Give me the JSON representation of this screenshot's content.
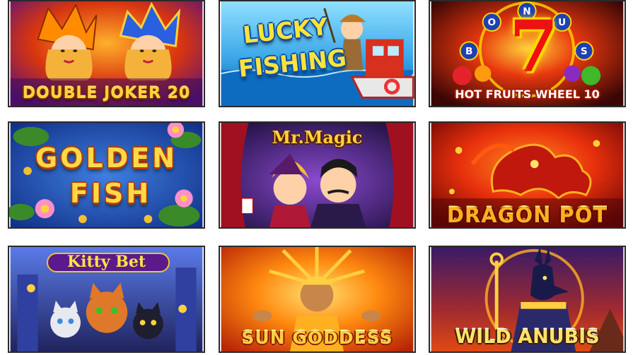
{
  "games": [
    {
      "title": "DOUBLE JOKER 20",
      "bg_top": "#d9360f",
      "bg_bottom": "#5a1278",
      "accent": "#ffd23a"
    },
    {
      "title_line1": "LUCKY",
      "title_line2": "FISHING",
      "bg_top": "#5fc4f2",
      "bg_bottom": "#0b67b8",
      "accent": "#ffe23a"
    },
    {
      "title": "HOT FRUITS WHEEL 10",
      "reel_letters": [
        "B",
        "O",
        "N",
        "U",
        "S"
      ],
      "big_symbol": "7",
      "bg_top": "#b01010",
      "bg_bottom": "#3a0606",
      "accent": "#ffd700"
    },
    {
      "title_line1": "GOLDEN",
      "title_line2": "FISH",
      "bg_top": "#2d63c9",
      "bg_bottom": "#11328a",
      "accent": "#ffd94a"
    },
    {
      "title": "Mr.Magic",
      "bg_top": "#3a1f7a",
      "bg_bottom": "#1c0e3c",
      "accent": "#ffd23a"
    },
    {
      "title": "DRAGON POT",
      "bg_top": "#f04a10",
      "bg_bottom": "#7a0808",
      "accent": "#ffb020"
    },
    {
      "title": "Kitty Bet",
      "bg_top": "#4a5fd0",
      "bg_bottom": "#20245e",
      "accent": "#ffe14a"
    },
    {
      "title": "SUN GODDESS",
      "bg_top": "#ff8a10",
      "bg_bottom": "#c23006",
      "accent": "#ffd040"
    },
    {
      "title": "WILD ANUBIS",
      "bg_top": "#3a1a66",
      "bg_bottom": "#e04a12",
      "accent": "#ffe36a"
    }
  ]
}
